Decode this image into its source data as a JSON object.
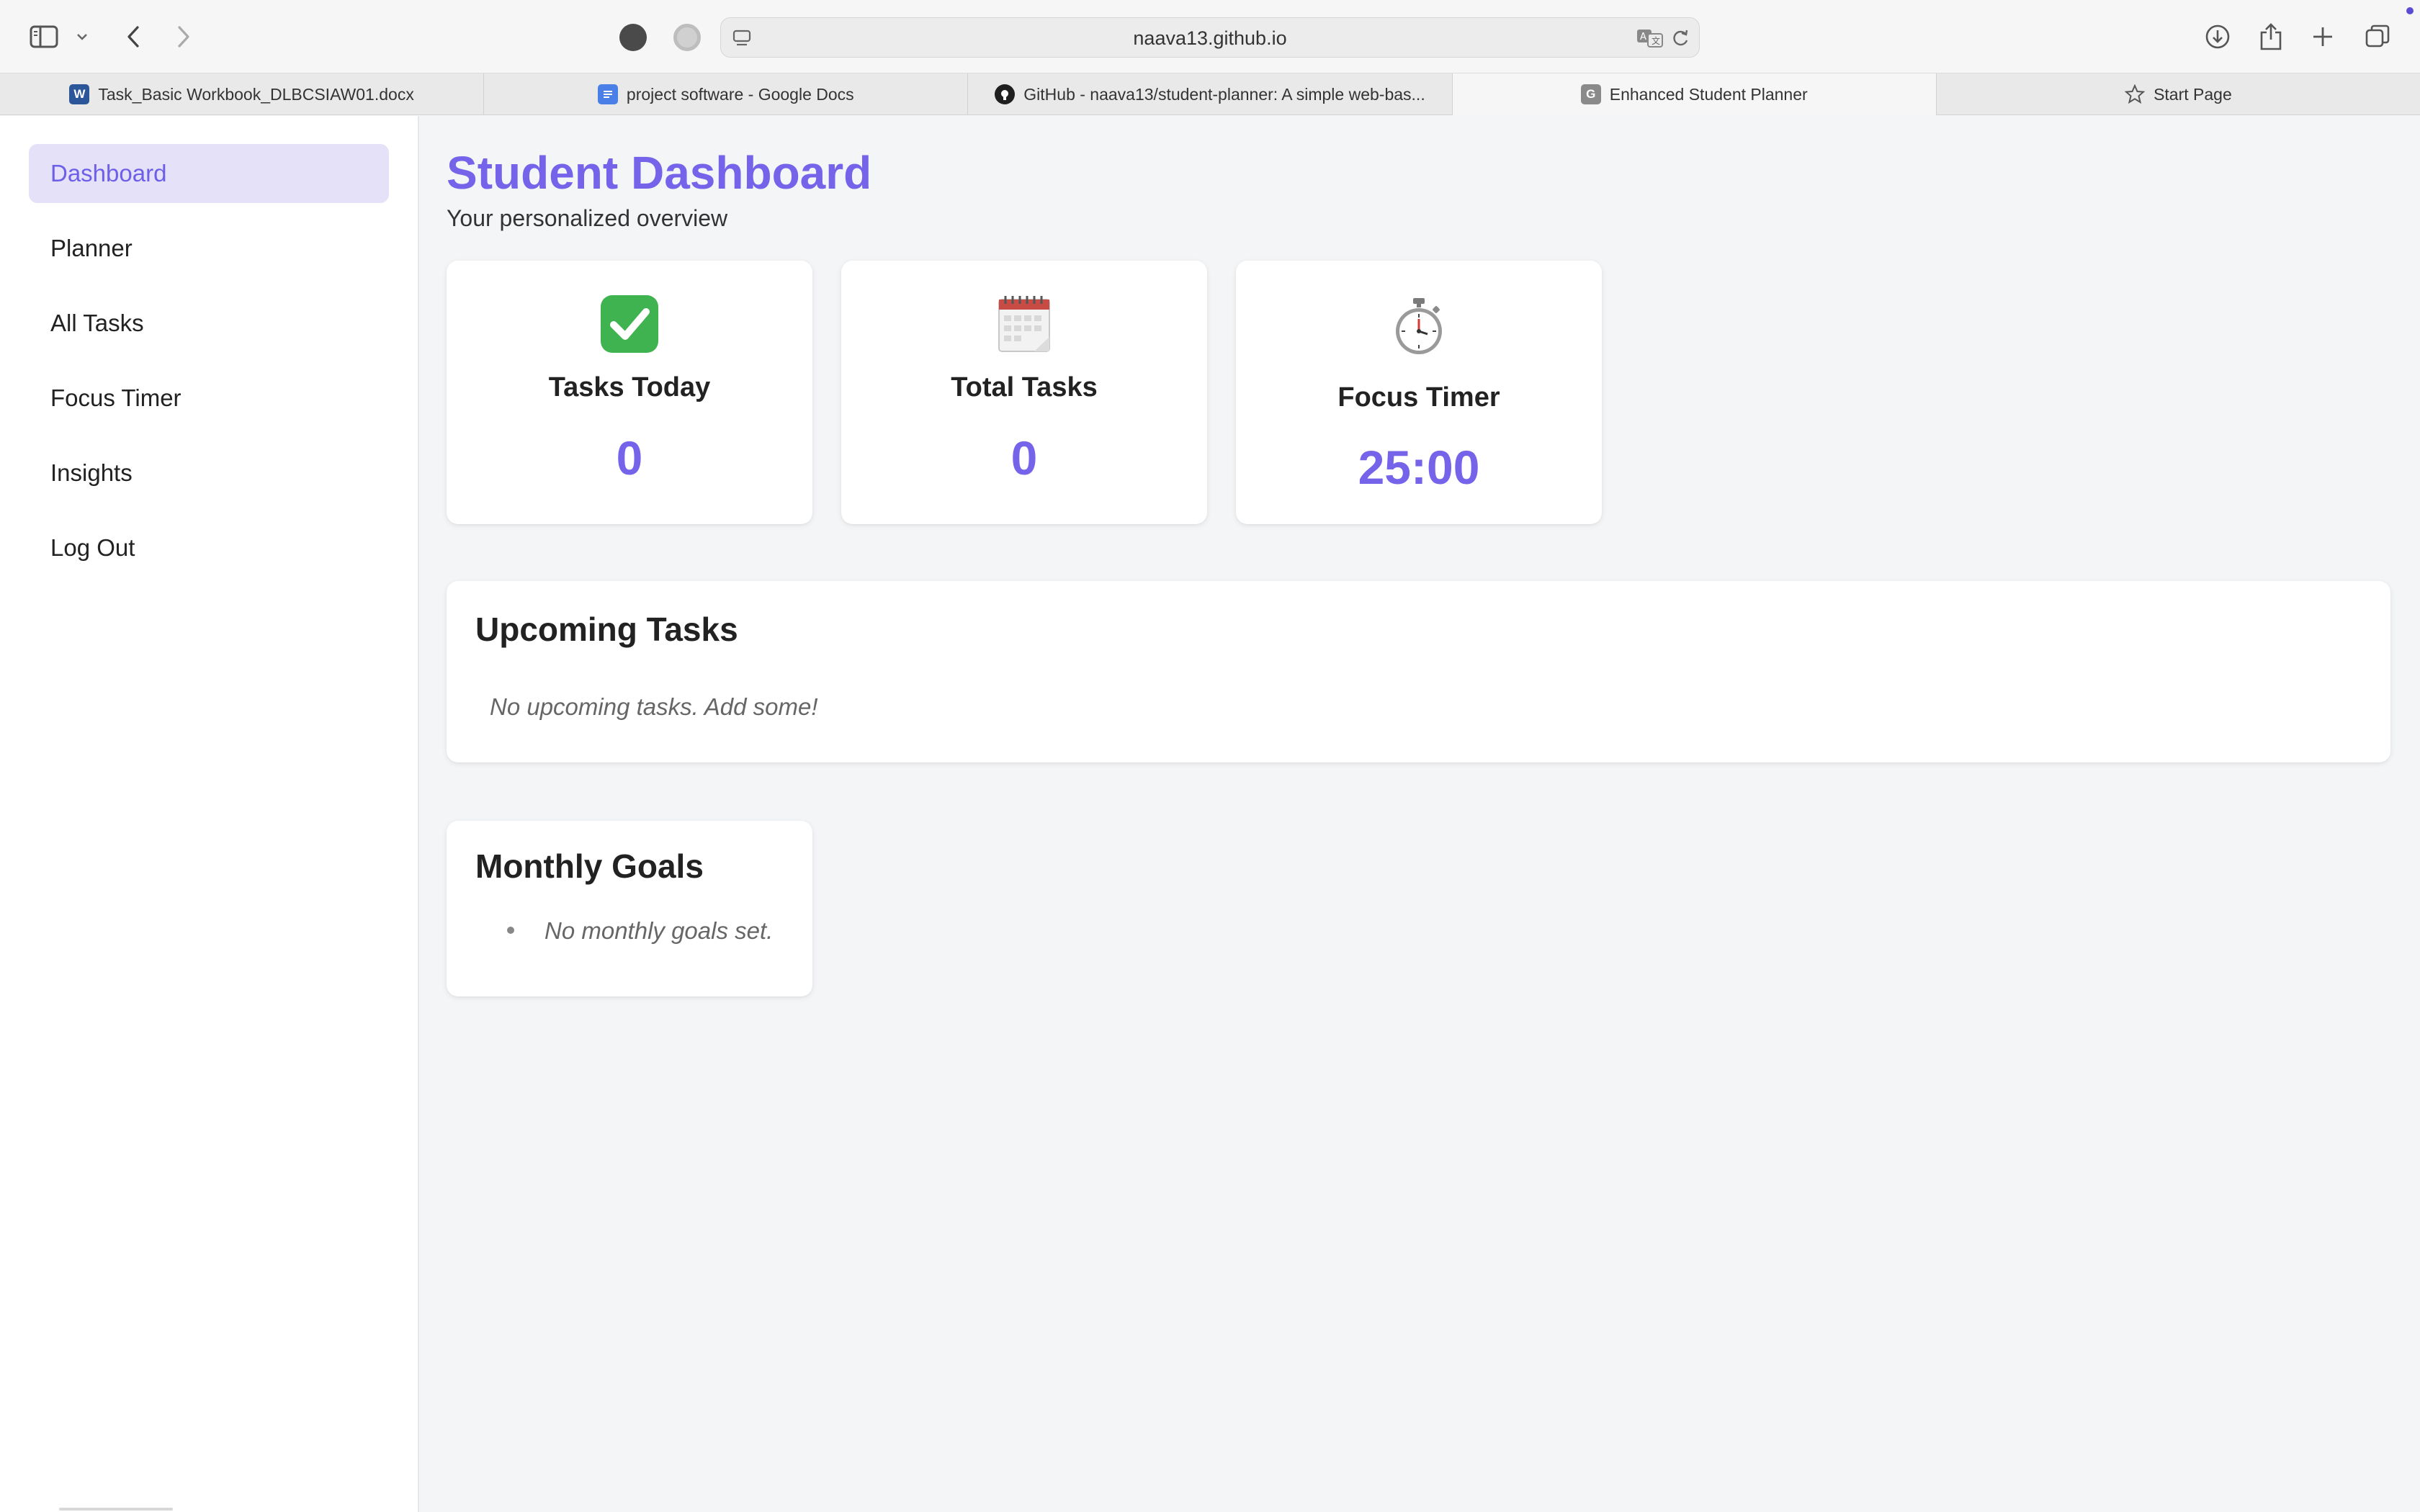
{
  "browser": {
    "url": "naava13.github.io",
    "tabs": [
      {
        "label": "Task_Basic Workbook_DLBCSIAW01.docx",
        "favicon": "word-icon",
        "active": false
      },
      {
        "label": "project software - Google Docs",
        "favicon": "google-docs-icon",
        "active": false
      },
      {
        "label": "GitHub - naava13/student-planner: A simple web-bas...",
        "favicon": "github-icon",
        "active": false
      },
      {
        "label": "Enhanced Student Planner",
        "favicon": "generic-g-icon",
        "active": true
      },
      {
        "label": "Start Page",
        "favicon": "star-icon",
        "active": false
      }
    ],
    "favicon_letters": {
      "word": "W",
      "generic": "G"
    }
  },
  "sidebar": {
    "items": [
      {
        "label": "Dashboard",
        "active": true
      },
      {
        "label": "Planner",
        "active": false
      },
      {
        "label": "All Tasks",
        "active": false
      },
      {
        "label": "Focus Timer",
        "active": false
      },
      {
        "label": "Insights",
        "active": false
      },
      {
        "label": "Log Out",
        "active": false
      }
    ]
  },
  "header": {
    "title": "Student Dashboard",
    "subtitle": "Your personalized overview"
  },
  "stats": [
    {
      "label": "Tasks Today",
      "value": "0",
      "icon": "check-mark-icon"
    },
    {
      "label": "Total Tasks",
      "value": "0",
      "icon": "calendar-icon"
    },
    {
      "label": "Focus Timer",
      "value": "25:00",
      "icon": "stopwatch-icon"
    }
  ],
  "upcoming": {
    "title": "Upcoming Tasks",
    "empty": "No upcoming tasks. Add some!"
  },
  "goals": {
    "title": "Monthly Goals",
    "items": [
      "No monthly goals set."
    ]
  },
  "colors": {
    "accent": "#7563ea",
    "active_nav_bg": "#e4e1f9",
    "check_green": "#3fb34f"
  }
}
